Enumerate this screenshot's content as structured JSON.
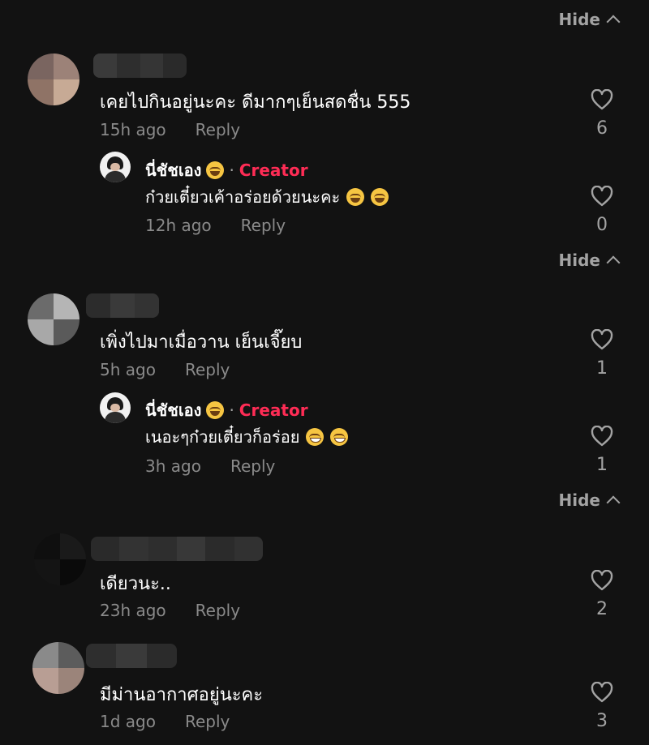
{
  "hide_label": "Hide",
  "comments": [
    {
      "text": "เคยไปกินอยู่นะคะ ดีมากๆเย็นสดชื่น 555",
      "time": "15h ago",
      "reply_label": "Reply",
      "likes": "6",
      "reply": {
        "name": "นี่ชัชเอง",
        "separator": "·",
        "badge": "Creator",
        "text": "ก๋วยเตี๋ยวเค้าอร่อยด้วยนะคะ",
        "time": "12h ago",
        "reply_label": "Reply",
        "likes": "0"
      }
    },
    {
      "text": "เพิ่งไปมาเมื่อวาน เย็นเจี๊ยบ",
      "time": "5h ago",
      "reply_label": "Reply",
      "likes": "1",
      "reply": {
        "name": "นี่ชัชเอง",
        "separator": "·",
        "badge": "Creator",
        "text": "เนอะๆก๋วยเตี๋ยวก็อร่อย",
        "time": "3h ago",
        "reply_label": "Reply",
        "likes": "1"
      }
    },
    {
      "text": "เดียวนะ..",
      "time": "23h ago",
      "reply_label": "Reply",
      "likes": "2"
    },
    {
      "text": "มีม่านอากาศอยู่นะคะ",
      "time": "1d ago",
      "reply_label": "Reply",
      "likes": "3"
    }
  ],
  "colors": {
    "background": "#121212",
    "creator": "#fe2c55",
    "muted": "#8a8a8a"
  }
}
